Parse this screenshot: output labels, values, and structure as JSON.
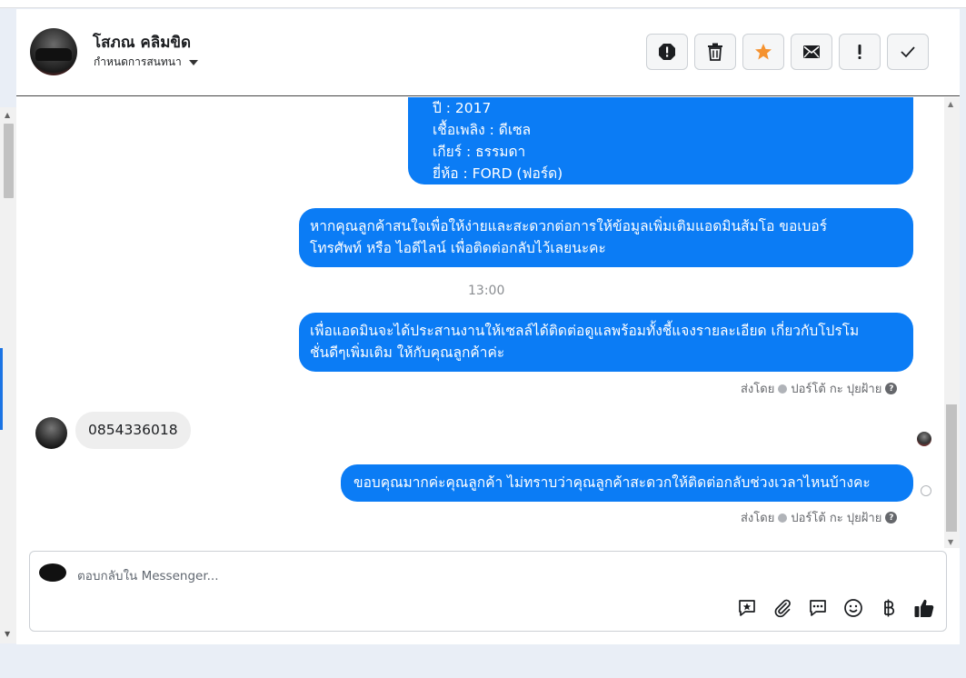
{
  "header": {
    "contact_name": "โสภณ คลิมขิด",
    "conversation_label": "กำหนดการสนทนา",
    "actions": [
      {
        "name": "report-button",
        "icon": "alert-octagon-icon"
      },
      {
        "name": "delete-button",
        "icon": "trash-icon"
      },
      {
        "name": "star-button",
        "icon": "star-icon"
      },
      {
        "name": "mark-unread-button",
        "icon": "envelope-icon"
      },
      {
        "name": "important-button",
        "icon": "exclamation-icon"
      },
      {
        "name": "done-button",
        "icon": "check-icon"
      }
    ],
    "accent_color": "#f5922f"
  },
  "messages": {
    "car_info": {
      "year": "ปี : 2017",
      "fuel": "เชื้อเพลิง : ดีเซล",
      "gear": "เกียร์ : ธรรมดา",
      "brand": "ยี่ห้อ : FORD (ฟอร์ด)"
    },
    "msg_contact_request": {
      "line1": "หากคุณลูกค้าสนใจเพื่อให้ง่ายและสะดวกต่อการให้ข้อมูลเพิ่มเติมแอดมินส้มโอ ขอเบอร์",
      "line2": "โทรศัพท์ หรือ ไอดีไลน์ เพื่อติดต่อกลับไว้เลยนะคะ"
    },
    "timestamp": "13:00",
    "msg_coordinate": {
      "line1": "เพื่อแอดมินจะได้ประสานงานให้เซลล์ได้ติดต่อดูแลพร้อมทั้งชี้แจงรายละเอียด เกี่ยวกับโปรโม",
      "line2": "ชั่นดีๆเพิ่มเติม ให้กับคุณลูกค้าค่ะ"
    },
    "sent_by_1": "ส่งโดย",
    "sender_1": "ปอร์โต้ กะ ปุยฝ้าย",
    "incoming_phone": "0854336018",
    "msg_thanks": "ขอบคุณมากค่ะคุณลูกค้า ไม่ทราบว่าคุณลูกค้าสะดวกให้ติดต่อกลับช่วงเวลาไหนบ้างคะ",
    "sent_by_2": "ส่งโดย",
    "sender_2": "ปอร์โต้ กะ ปุยฝ้าย",
    "bubble_color": "#0b7cf5"
  },
  "composer": {
    "placeholder": "ตอบกลับใน Messenger...",
    "value": "",
    "tools": [
      {
        "name": "saved-reply-button",
        "icon": "chat-star-icon"
      },
      {
        "name": "attach-button",
        "icon": "paperclip-icon"
      },
      {
        "name": "quick-reply-button",
        "icon": "chat-dots-icon"
      },
      {
        "name": "emoji-button",
        "icon": "smile-icon"
      },
      {
        "name": "payment-button",
        "icon": "baht-icon"
      },
      {
        "name": "like-button",
        "icon": "thumbs-up-icon"
      }
    ]
  }
}
